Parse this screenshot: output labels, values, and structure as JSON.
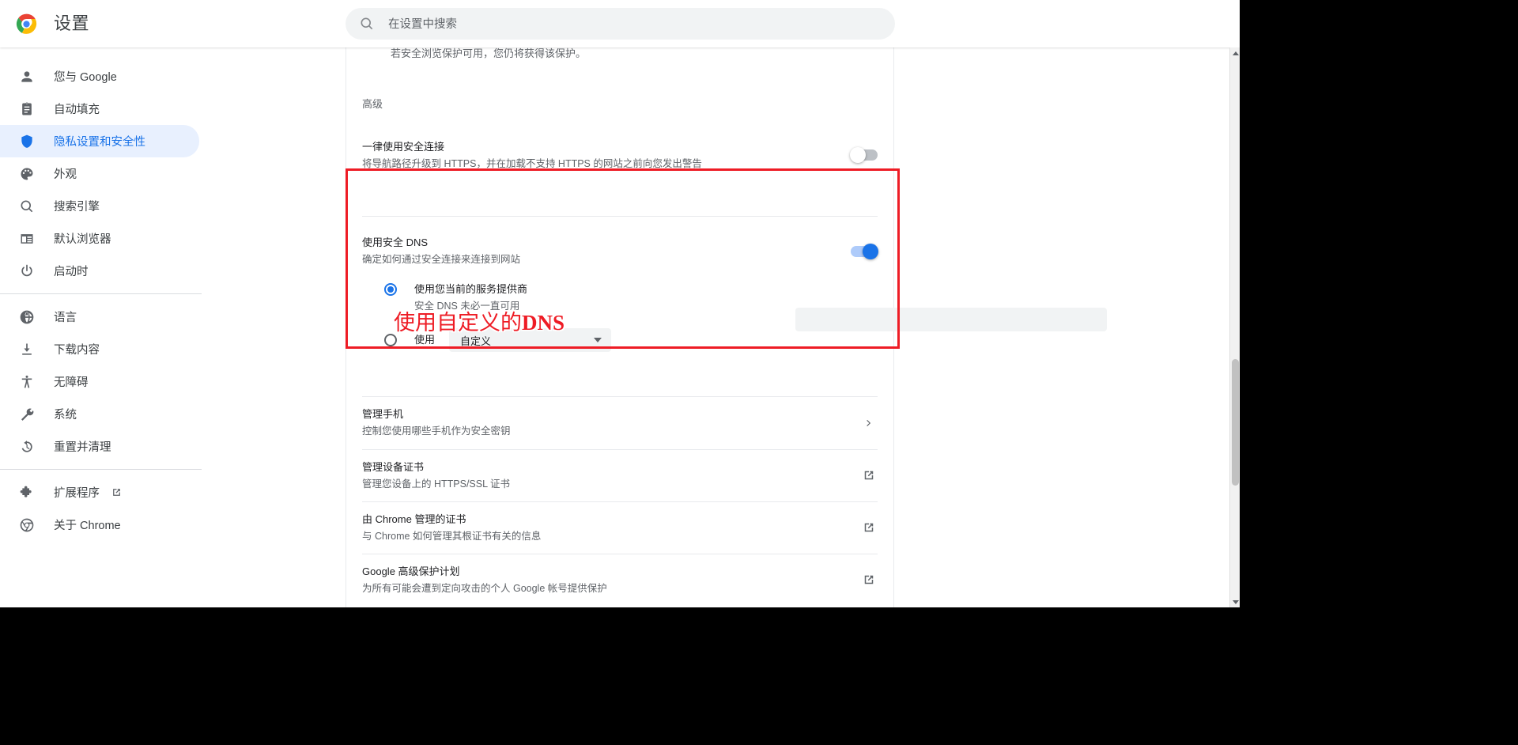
{
  "header": {
    "title": "设置",
    "logo_icon": "chrome-logo",
    "search": {
      "icon": "search-icon",
      "placeholder": "在设置中搜索",
      "value": ""
    }
  },
  "sidebar": {
    "groups": [
      {
        "items": [
          {
            "icon": "person-icon",
            "label": "您与 Google",
            "selected": false,
            "external": false
          },
          {
            "icon": "autofill-icon",
            "label": "自动填充",
            "selected": false,
            "external": false
          },
          {
            "icon": "shield-icon",
            "label": "隐私设置和安全性",
            "selected": true,
            "external": false
          },
          {
            "icon": "palette-icon",
            "label": "外观",
            "selected": false,
            "external": false
          },
          {
            "icon": "search-icon",
            "label": "搜索引擎",
            "selected": false,
            "external": false
          },
          {
            "icon": "browser-icon",
            "label": "默认浏览器",
            "selected": false,
            "external": false
          },
          {
            "icon": "power-icon",
            "label": "启动时",
            "selected": false,
            "external": false
          }
        ]
      },
      {
        "items": [
          {
            "icon": "globe-icon",
            "label": "语言",
            "selected": false,
            "external": false
          },
          {
            "icon": "download-icon",
            "label": "下载内容",
            "selected": false,
            "external": false
          },
          {
            "icon": "accessible-icon",
            "label": "无障碍",
            "selected": false,
            "external": false
          },
          {
            "icon": "wrench-icon",
            "label": "系统",
            "selected": false,
            "external": false
          },
          {
            "icon": "restore-icon",
            "label": "重置并清理",
            "selected": false,
            "external": false
          }
        ]
      },
      {
        "items": [
          {
            "icon": "puzzle-icon",
            "label": "扩展程序",
            "selected": false,
            "external": true
          },
          {
            "icon": "chrome-ring-icon",
            "label": "关于 Chrome",
            "selected": false,
            "external": false
          }
        ]
      }
    ]
  },
  "main": {
    "cut_off_text": "若安全浏览保护可用，您仍将获得该保护。",
    "section_header": "高级",
    "https_row": {
      "title": "一律使用安全连接",
      "description": "将导航路径升级到 HTTPS，并在加载不支持 HTTPS 的网站之前向您发出警告",
      "toggle_state": "off"
    },
    "dns": {
      "title": "使用安全 DNS",
      "description": "确定如何通过安全连接来连接到网站",
      "toggle_state": "on",
      "options": [
        {
          "label": "使用您当前的服务提供商",
          "sublabel": "安全 DNS 未必一直可用",
          "checked": true
        },
        {
          "label": "使用",
          "sublabel": "",
          "checked": false
        }
      ],
      "provider_select": {
        "value": "自定义",
        "caret_icon": "chevron-down-icon"
      },
      "custom_input": {
        "value": "",
        "placeholder": ""
      }
    },
    "rows": [
      {
        "title": "管理手机",
        "description": "控制您使用哪些手机作为安全密钥",
        "action_icon": "chevron-right-icon"
      },
      {
        "title": "管理设备证书",
        "description": "管理您设备上的 HTTPS/SSL 证书",
        "action_icon": "external-link-icon"
      },
      {
        "title": "由 Chrome 管理的证书",
        "description": "与 Chrome 如何管理其根证书有关的信息",
        "action_icon": "external-link-icon"
      },
      {
        "title": "Google 高级保护计划",
        "description": "为所有可能会遭到定向攻击的个人 Google 帐号提供保护",
        "action_icon": "external-link-icon"
      }
    ]
  },
  "annotation": {
    "text_cn": "使用自定义的",
    "text_en": "DNS",
    "color": "#ee1c25"
  },
  "colors": {
    "accent": "#1a73e8",
    "selected_bg": "#e8f0fe",
    "text_primary": "#202124",
    "text_secondary": "#5f6368",
    "field_bg": "#f1f3f4",
    "annotation_red": "#ee1c25"
  },
  "scrollbar": {
    "up_arrow_icon": "scroll-up-arrow-icon",
    "down_arrow_icon": "scroll-down-arrow-icon"
  }
}
